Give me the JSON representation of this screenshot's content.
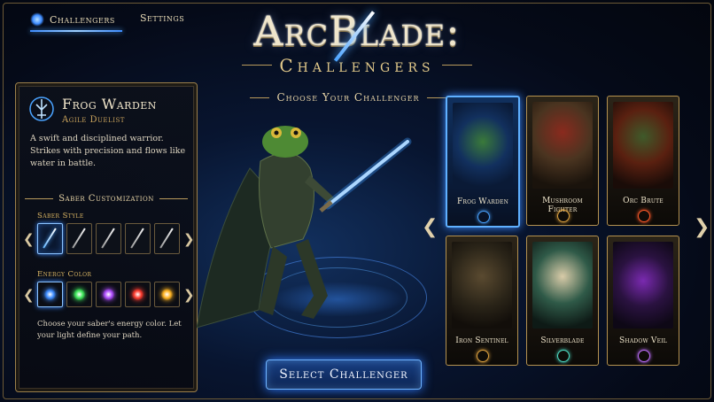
{
  "nav": {
    "challengers_label": "Challengers",
    "settings_label": "Settings",
    "active_tab": "Challengers"
  },
  "logo": {
    "title": "ArcBlade:",
    "subtitle": "Challengers"
  },
  "choose_header": "Choose Your Challenger",
  "character": {
    "name": "Frog Warden",
    "class": "Agile Duelist",
    "description": "A swift and disciplined warrior. Strikes with precision and flows like water in battle."
  },
  "customization": {
    "title": "Saber Customization",
    "saber_style_label": "Saber Style",
    "saber_styles": [
      "blue-saber",
      "silver-saber-1",
      "silver-saber-2",
      "silver-saber-3",
      "silver-saber-4"
    ],
    "selected_saber": 0,
    "energy_color_label": "Energy Color",
    "energy_colors": [
      {
        "name": "blue",
        "hex": "#3d8bff"
      },
      {
        "name": "green",
        "hex": "#3ee85a"
      },
      {
        "name": "purple",
        "hex": "#b04dff"
      },
      {
        "name": "red",
        "hex": "#ff3b2e"
      },
      {
        "name": "gold",
        "hex": "#ffb320"
      }
    ],
    "selected_color": 0,
    "hint": "Choose your saber's energy color. Let your light define your path."
  },
  "roster": [
    {
      "name": "Frog Warden",
      "accent": "#4aa3ff",
      "selected": true
    },
    {
      "name": "Mushroom Fighter",
      "accent": "#e0a440",
      "selected": false
    },
    {
      "name": "Orc Brute",
      "accent": "#ff5a2a",
      "selected": false
    },
    {
      "name": "Iron Sentinel",
      "accent": "#e0a440",
      "selected": false
    },
    {
      "name": "Silverblade",
      "accent": "#4fe0c8",
      "selected": false
    },
    {
      "name": "Shadow Veil",
      "accent": "#c070ff",
      "selected": false
    }
  ],
  "select_button": "Select Challenger",
  "colors": {
    "gold": "#b5924f",
    "accent_blue": "#3d8bff"
  }
}
